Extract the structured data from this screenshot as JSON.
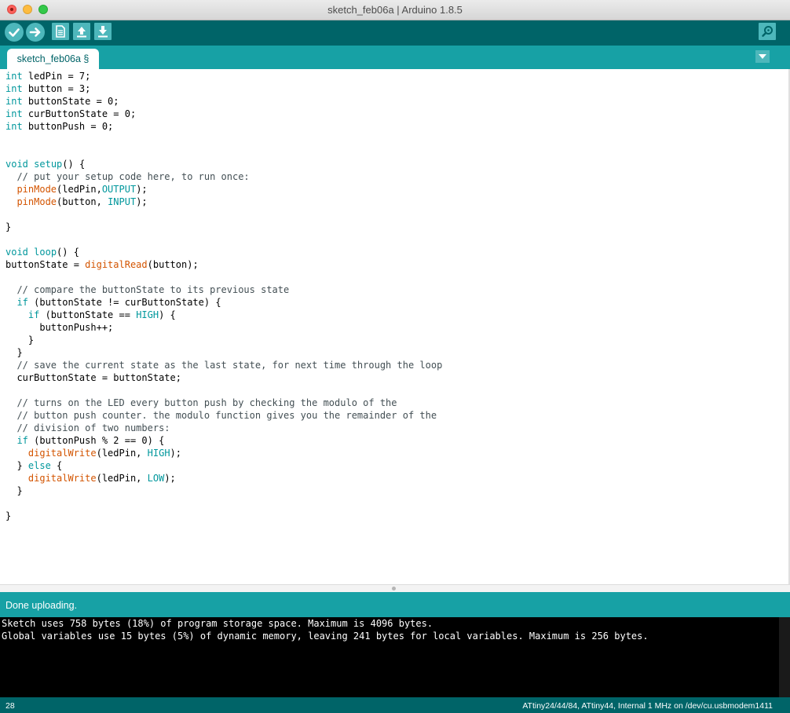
{
  "window": {
    "title": "sketch_feb06a | Arduino 1.8.5"
  },
  "toolbar": {
    "buttons": [
      {
        "name": "verify",
        "icon": "check-icon"
      },
      {
        "name": "upload",
        "icon": "arrow-right-icon"
      },
      {
        "name": "new",
        "icon": "document-icon"
      },
      {
        "name": "open",
        "icon": "arrow-up-icon"
      },
      {
        "name": "save",
        "icon": "arrow-down-icon"
      },
      {
        "name": "serial-monitor",
        "icon": "magnifier-icon"
      }
    ]
  },
  "tabs": [
    {
      "label": "sketch_feb06a §",
      "active": true
    }
  ],
  "editor": {
    "lines": [
      [
        [
          "kw",
          "int"
        ],
        [
          "t",
          " ledPin = 7;"
        ]
      ],
      [
        [
          "kw",
          "int"
        ],
        [
          "t",
          " button = 3;"
        ]
      ],
      [
        [
          "kw",
          "int"
        ],
        [
          "t",
          " buttonState = 0;"
        ]
      ],
      [
        [
          "kw",
          "int"
        ],
        [
          "t",
          " curButtonState = 0;"
        ]
      ],
      [
        [
          "kw",
          "int"
        ],
        [
          "t",
          " buttonPush = 0;"
        ]
      ],
      [],
      [],
      [
        [
          "kw",
          "void"
        ],
        [
          "t",
          " "
        ],
        [
          "kw",
          "setup"
        ],
        [
          "t",
          "() {"
        ]
      ],
      [
        [
          "cm",
          "  // put your setup code here, to run once:"
        ]
      ],
      [
        [
          "t",
          "  "
        ],
        [
          "fn",
          "pinMode"
        ],
        [
          "t",
          "(ledPin,"
        ],
        [
          "kw",
          "OUTPUT"
        ],
        [
          "t",
          ");"
        ]
      ],
      [
        [
          "t",
          "  "
        ],
        [
          "fn",
          "pinMode"
        ],
        [
          "t",
          "(button, "
        ],
        [
          "kw",
          "INPUT"
        ],
        [
          "t",
          ");"
        ]
      ],
      [],
      [
        [
          "t",
          "}"
        ]
      ],
      [],
      [
        [
          "kw",
          "void"
        ],
        [
          "t",
          " "
        ],
        [
          "kw",
          "loop"
        ],
        [
          "t",
          "() {"
        ]
      ],
      [
        [
          "t",
          "buttonState = "
        ],
        [
          "fn",
          "digitalRead"
        ],
        [
          "t",
          "(button);"
        ]
      ],
      [],
      [
        [
          "cm",
          "  // compare the buttonState to its previous state"
        ]
      ],
      [
        [
          "t",
          "  "
        ],
        [
          "kw",
          "if"
        ],
        [
          "t",
          " (buttonState != curButtonState) {"
        ]
      ],
      [
        [
          "t",
          "    "
        ],
        [
          "kw",
          "if"
        ],
        [
          "t",
          " (buttonState == "
        ],
        [
          "kw",
          "HIGH"
        ],
        [
          "t",
          ") {"
        ]
      ],
      [
        [
          "t",
          "      buttonPush++;"
        ]
      ],
      [
        [
          "t",
          "    }"
        ]
      ],
      [
        [
          "t",
          "  }"
        ]
      ],
      [
        [
          "cm",
          "  // save the current state as the last state, for next time through the loop"
        ]
      ],
      [
        [
          "t",
          "  curButtonState = buttonState;"
        ]
      ],
      [],
      [
        [
          "cm",
          "  // turns on the LED every button push by checking the modulo of the"
        ]
      ],
      [
        [
          "cm",
          "  // button push counter. the modulo function gives you the remainder of the"
        ]
      ],
      [
        [
          "cm",
          "  // division of two numbers:"
        ]
      ],
      [
        [
          "t",
          "  "
        ],
        [
          "kw",
          "if"
        ],
        [
          "t",
          " (buttonPush % 2 == 0) {"
        ]
      ],
      [
        [
          "t",
          "    "
        ],
        [
          "fn",
          "digitalWrite"
        ],
        [
          "t",
          "(ledPin, "
        ],
        [
          "kw",
          "HIGH"
        ],
        [
          "t",
          ");"
        ]
      ],
      [
        [
          "t",
          "  } "
        ],
        [
          "kw",
          "else"
        ],
        [
          "t",
          " {"
        ]
      ],
      [
        [
          "t",
          "    "
        ],
        [
          "fn",
          "digitalWrite"
        ],
        [
          "t",
          "(ledPin, "
        ],
        [
          "kw",
          "LOW"
        ],
        [
          "t",
          ");"
        ]
      ],
      [
        [
          "t",
          "  }"
        ]
      ],
      [],
      [
        [
          "t",
          "}"
        ]
      ]
    ]
  },
  "status": {
    "message": "Done uploading."
  },
  "console": {
    "lines": [
      "Sketch uses 758 bytes (18%) of program storage space. Maximum is 4096 bytes.",
      "Global variables use 15 bytes (5%) of dynamic memory, leaving 241 bytes for local variables. Maximum is 256 bytes."
    ]
  },
  "footer": {
    "line_number": "28",
    "board": "ATtiny24/44/84, ATtiny44, Internal 1 MHz on /dev/cu.usbmodem1411"
  },
  "colors": {
    "toolbar": "#006468",
    "tabbar": "#17a1a5",
    "button": "#4db7bb",
    "keyword": "#00979c",
    "function": "#d35400",
    "comment": "#434f54"
  }
}
